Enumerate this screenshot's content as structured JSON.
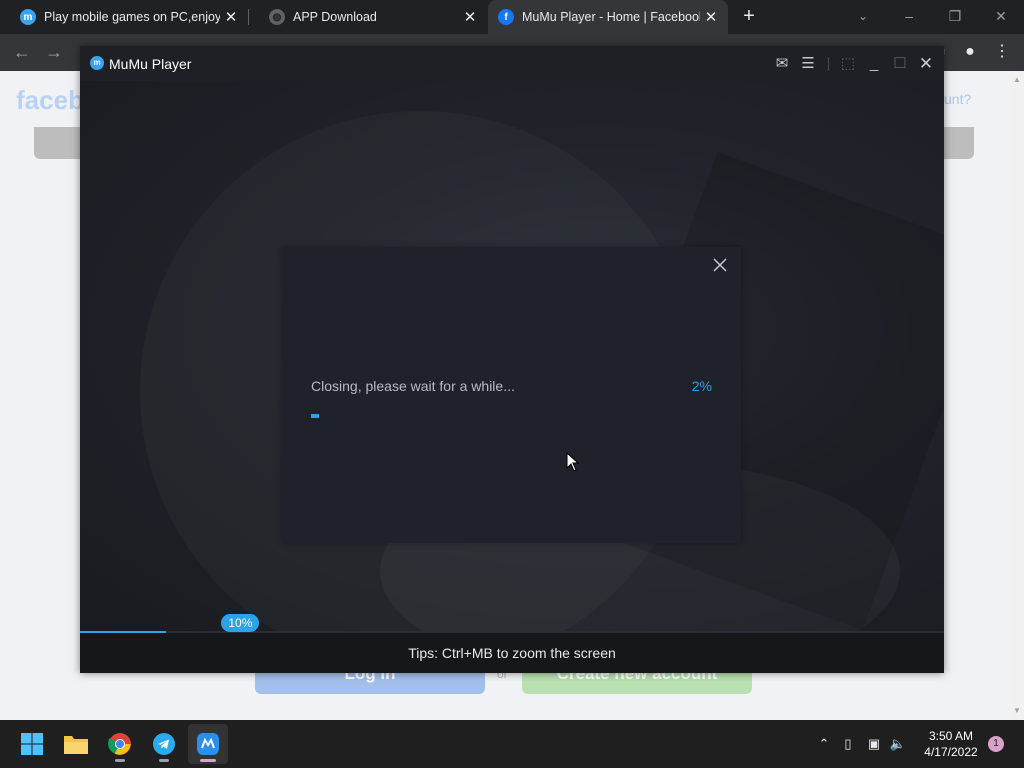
{
  "browser": {
    "tabs": [
      {
        "title": "Play mobile games on PC,enjoy a",
        "favicon": "mumu-favicon",
        "active": false
      },
      {
        "title": "APP Download",
        "favicon": "globe-icon",
        "active": false
      },
      {
        "title": "MuMu Player - Home | Facebook",
        "favicon": "facebook-favicon",
        "active": true
      }
    ],
    "new_tab_glyph": "+",
    "accent": "#2ba3e8"
  },
  "page": {
    "logo_fragment": "faceb",
    "forgot_fragment": "unt?",
    "login_label": "Log In",
    "or_label": "or",
    "create_label": "Create new account"
  },
  "mumu": {
    "title": "MuMu Player",
    "boot_progress": {
      "value": 10,
      "label": "10%"
    },
    "tips": "Tips: Ctrl+MB to zoom the screen",
    "dialog": {
      "message": "Closing, please wait for a while...",
      "progress": {
        "value": 2,
        "label": "2%"
      }
    }
  },
  "taskbar": {
    "apps": [
      "windows-start-icon",
      "file-explorer-icon",
      "chrome-icon",
      "telegram-icon",
      "mumu-player-icon"
    ],
    "time": "3:50 AM",
    "date": "4/17/2022",
    "notifications": "1"
  }
}
